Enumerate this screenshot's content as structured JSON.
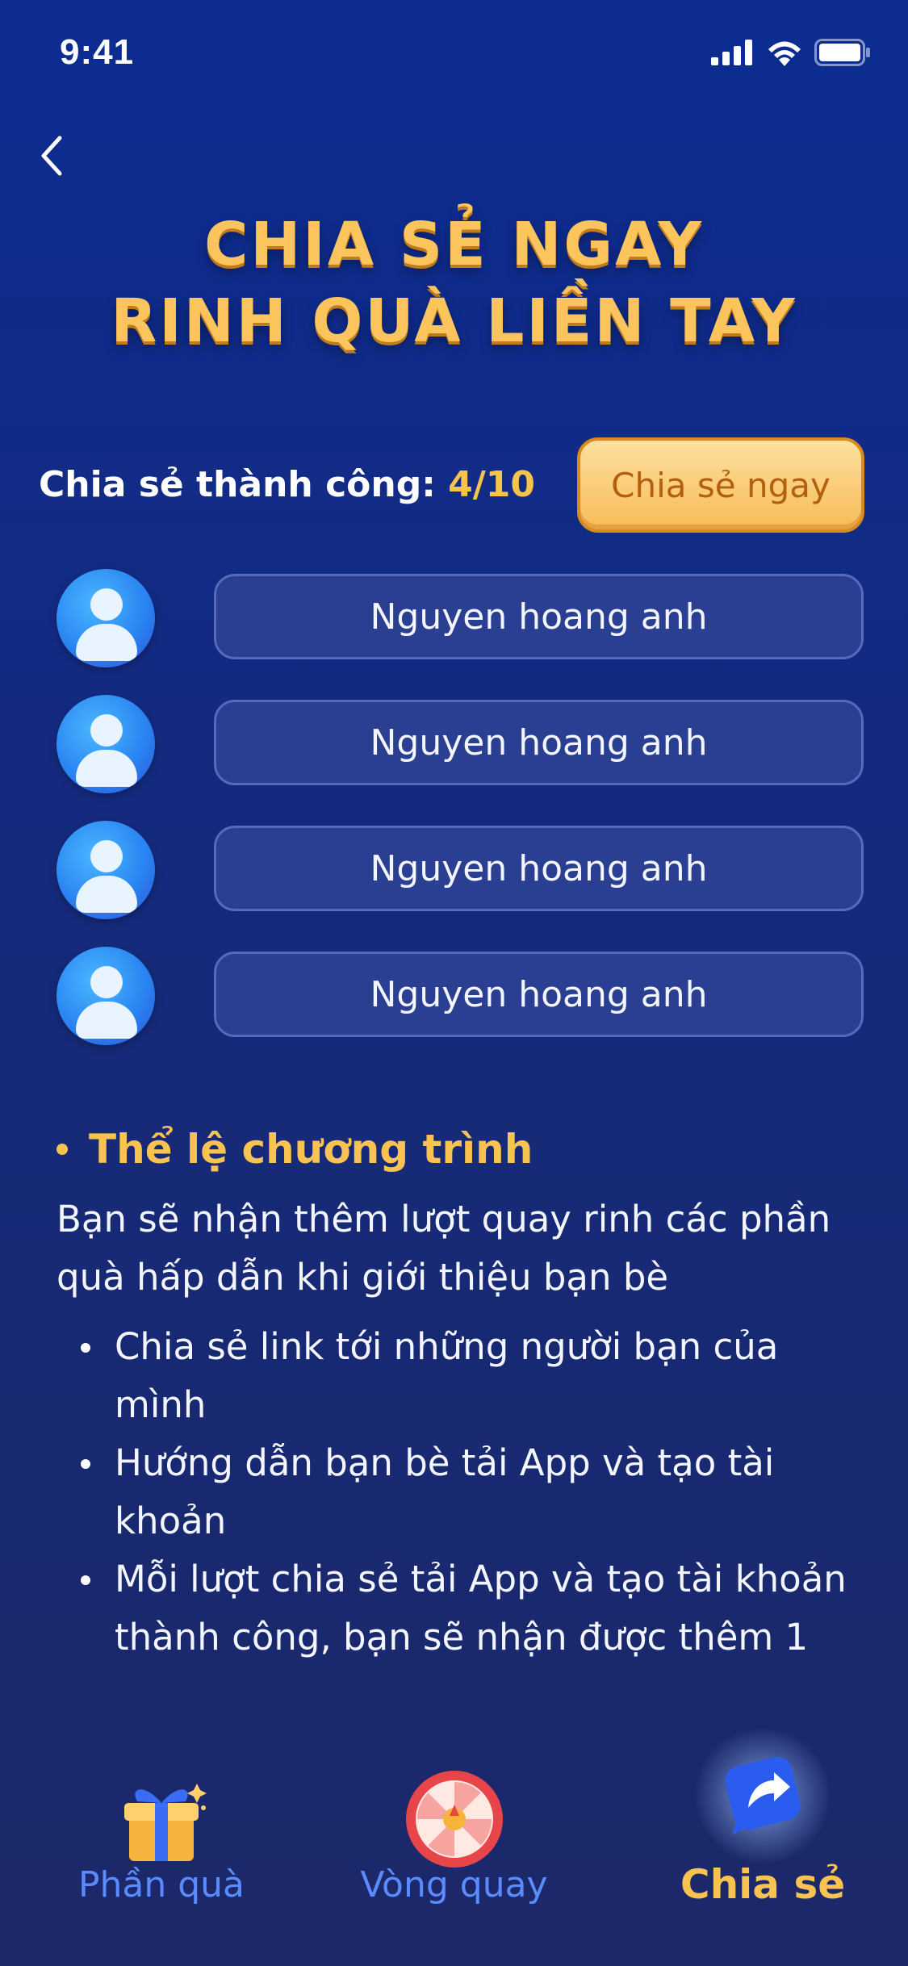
{
  "status_bar": {
    "time": "9:41"
  },
  "header": {
    "title_line1": "CHIA SẺ NGAY",
    "title_line2": "RINH QUÀ LIỀN TAY"
  },
  "share": {
    "label": "Chia sẻ thành công: ",
    "count": "4/10",
    "button_label": "Chia sẻ ngay"
  },
  "friends": [
    {
      "name": "Nguyen hoang anh"
    },
    {
      "name": "Nguyen hoang anh"
    },
    {
      "name": "Nguyen hoang anh"
    },
    {
      "name": "Nguyen hoang anh"
    }
  ],
  "rules": {
    "heading": "Thể lệ chương trình",
    "intro": "Bạn sẽ nhận thêm lượt quay rinh các phần quà hấp dẫn khi giới thiệu bạn bè",
    "items": [
      "Chia sẻ link tới những người bạn của mình",
      "Hướng dẫn bạn bè tải App và tạo tài khoản",
      "Mỗi lượt chia sẻ tải App và tạo tài khoản thành công, bạn sẽ nhận được thêm 1"
    ]
  },
  "tabs": [
    {
      "label": "Phần quà",
      "icon": "gift-icon",
      "active": false
    },
    {
      "label": "Vòng quay",
      "icon": "wheel-icon",
      "active": false
    },
    {
      "label": "Chia sẻ",
      "icon": "share-icon",
      "active": true
    }
  ],
  "colors": {
    "accent_gold": "#f9c351",
    "tab_inactive": "#5a8cff",
    "background_top": "#0c2c92",
    "background_bottom": "#1c2868"
  }
}
